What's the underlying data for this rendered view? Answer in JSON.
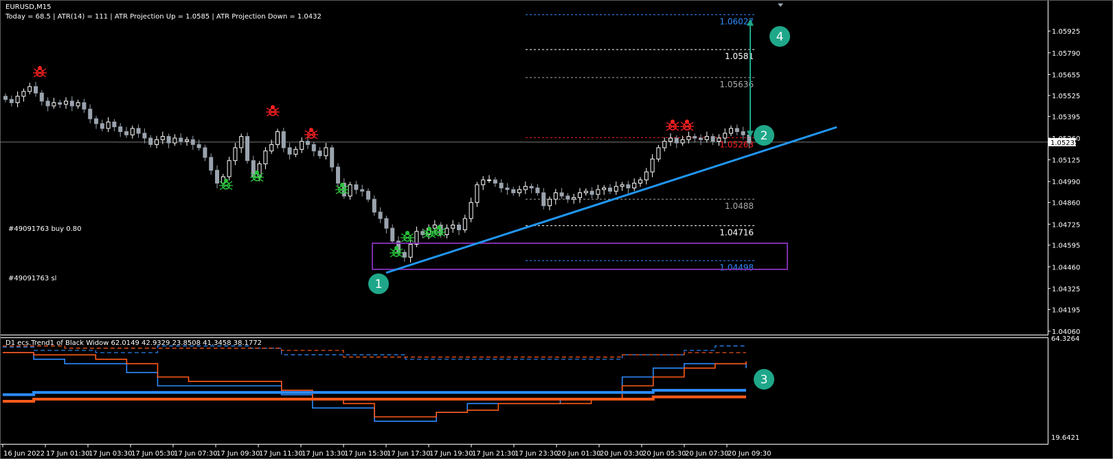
{
  "header": {
    "symbol": "EURUSD,M15",
    "info": "Today = 68.5   |   ATR(14) = 111   |   ATR Projection Up = 1.0585   |   ATR Projection Down = 1.0432"
  },
  "indicator_label": "D1 ecs.Trend1 of Black Widow  62.0149 42.9329 23.8508 41.3458 38.1772",
  "current_price": "1.05235",
  "trades": [
    {
      "label": "#49091763 buy 0.80"
    },
    {
      "label": "#49091763 sl"
    }
  ],
  "callouts": [
    "1",
    "2",
    "3",
    "4"
  ],
  "colors": {
    "background": "#000000",
    "bull_candle": "#ffffff",
    "bear_candle": "#9aa3ad",
    "trend_line": "#2196f3",
    "box": "#7b2fa8",
    "callout": "#1fa78a",
    "indicator_blue": "#2d8cff",
    "indicator_orange": "#ff5a1a",
    "level_blue": "#2d8cff",
    "level_red": "#ff2020",
    "level_gray": "#aaaaaa"
  },
  "icons": [
    "red-spider-sell-icon",
    "green-spider-buy-icon",
    "price-marker-triangle-icon"
  ],
  "chart_data": [
    {
      "type": "candlestick",
      "title": "EURUSD,M15",
      "price_axis": {
        "ticks": [
          "1.05925",
          "1.05790",
          "1.05655",
          "1.05525",
          "1.05395",
          "1.05260",
          "1.05125",
          "1.04990",
          "1.04860",
          "1.04725",
          "1.04595",
          "1.04460",
          "1.04325",
          "1.04195",
          "1.04060"
        ],
        "ylim": [
          1.0406,
          1.0599
        ]
      },
      "time_axis": {
        "ticks": [
          "16 Jun 2022",
          "17 Jun 01:30",
          "17 Jun 03:30",
          "17 Jun 05:30",
          "17 Jun 07:30",
          "17 Jun 09:30",
          "17 Jun 11:30",
          "17 Jun 13:30",
          "17 Jun 15:30",
          "17 Jun 17:30",
          "17 Jun 19:30",
          "17 Jun 21:30",
          "17 Jun 23:30",
          "20 Jun 01:30",
          "20 Jun 03:30",
          "20 Jun 05:30",
          "20 Jun 07:30",
          "20 Jun 09:30"
        ]
      },
      "candle_close_path": [
        1.055,
        1.0548,
        1.0552,
        1.0555,
        1.0558,
        1.0554,
        1.0549,
        1.0546,
        1.0548,
        1.0547,
        1.0549,
        1.0546,
        1.0548,
        1.0544,
        1.0538,
        1.0535,
        1.0532,
        1.0536,
        1.0533,
        1.053,
        1.0528,
        1.0532,
        1.0529,
        1.0526,
        1.0522,
        1.0525,
        1.0527,
        1.0523,
        1.0526,
        1.0524,
        1.0525,
        1.0522,
        1.052,
        1.0514,
        1.0506,
        1.0498,
        1.0502,
        1.0512,
        1.052,
        1.0527,
        1.0512,
        1.0502,
        1.051,
        1.0518,
        1.0522,
        1.053,
        1.052,
        1.0516,
        1.0519,
        1.0524,
        1.0522,
        1.0518,
        1.0515,
        1.052,
        1.0508,
        1.0498,
        1.049,
        1.0497,
        1.0494,
        1.0493,
        1.0488,
        1.048,
        1.0476,
        1.047,
        1.0462,
        1.0455,
        1.0452,
        1.046,
        1.0468,
        1.0466,
        1.047,
        1.0472,
        1.0466,
        1.047,
        1.0472,
        1.0469,
        1.0476,
        1.0486,
        1.0497,
        1.05,
        1.05,
        1.0498,
        1.0495,
        1.0494,
        1.0492,
        1.0494,
        1.0496,
        1.0495,
        1.0492,
        1.0484,
        1.0488,
        1.0492,
        1.049,
        1.0488,
        1.0489,
        1.0492,
        1.0493,
        1.0491,
        1.0494,
        1.0495,
        1.0493,
        1.0496,
        1.0497,
        1.0495,
        1.0498,
        1.05,
        1.0505,
        1.0513,
        1.052,
        1.0524,
        1.0526,
        1.0523,
        1.0525,
        1.0527,
        1.0526,
        1.0525,
        1.0527,
        1.0524,
        1.0526,
        1.0529,
        1.0532,
        1.053,
        1.0528,
        1.0523
      ],
      "levels": [
        {
          "value": "1.06027",
          "color": "blue"
        },
        {
          "value": "1.0581",
          "color": "gray"
        },
        {
          "value": "1.05636",
          "color": "gray"
        },
        {
          "value": "1.05263",
          "color": "red"
        },
        {
          "value": "1.0488",
          "color": "gray"
        },
        {
          "value": "1.04716",
          "color": "gray"
        },
        {
          "value": "1.04498",
          "color": "blue"
        }
      ],
      "annotations": {
        "trend_line": "rising blue line from swing low (~1.0446) to current area (~1.0527)",
        "range_box": "purple rectangle around 1.0450–1.0464",
        "atr_arrow": "double-headed green arrow from 1.05263 to 1.06027"
      }
    },
    {
      "type": "line",
      "title": "D1 ecs.Trend1 of Black Widow",
      "ylim": [
        19.6421,
        64.3264
      ],
      "ticks": [
        "64.3264",
        "19.6421"
      ],
      "values": [
        62.0149,
        42.9329,
        23.8508,
        41.3458,
        38.1772
      ],
      "series": [
        {
          "color": "blue",
          "style": "dashed"
        },
        {
          "color": "orange",
          "style": "dashed"
        },
        {
          "color": "blue",
          "style": "thin"
        },
        {
          "color": "orange",
          "style": "thin"
        },
        {
          "color": "blue",
          "style": "thick"
        },
        {
          "color": "orange",
          "style": "thick"
        }
      ]
    }
  ]
}
